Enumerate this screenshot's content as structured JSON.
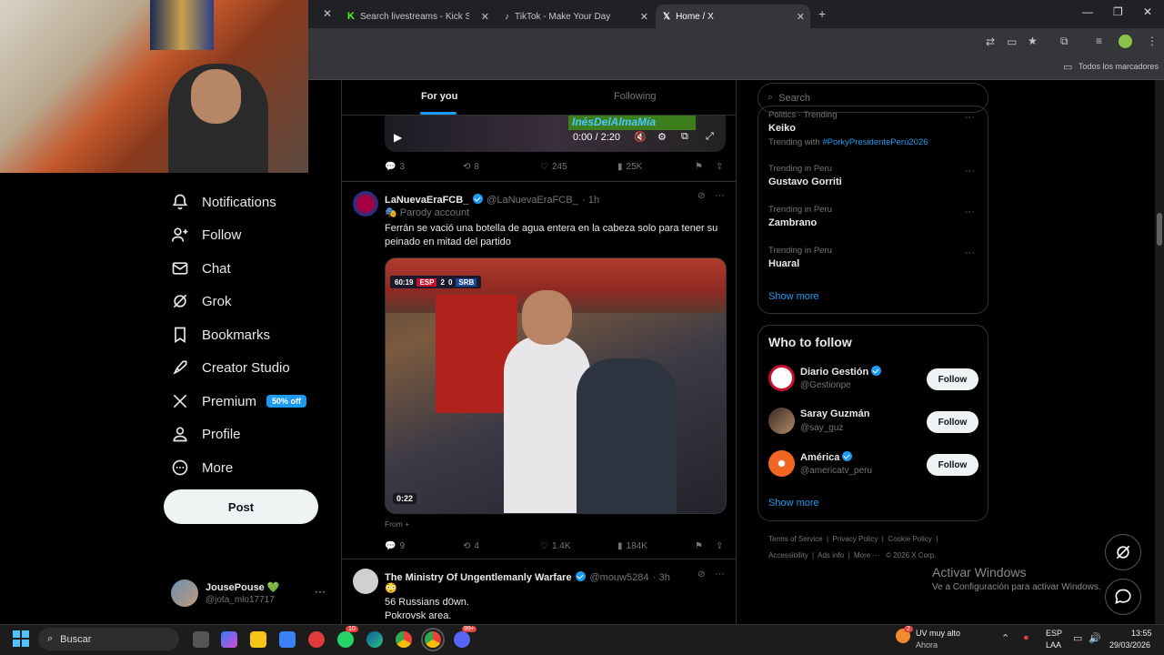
{
  "browser": {
    "tabs": [
      {
        "label": "Search livestreams - Kick Stream",
        "icon": "kick-icon"
      },
      {
        "label": "TikTok - Make Your Day",
        "icon": "tiktok-icon"
      },
      {
        "label": "Home / X",
        "icon": "x-icon"
      }
    ],
    "bookmarks_label": "Todos los marcadores"
  },
  "nav": {
    "items": [
      {
        "label": "Notifications",
        "icon": "bell-icon"
      },
      {
        "label": "Follow",
        "icon": "person-plus-icon"
      },
      {
        "label": "Chat",
        "icon": "mail-icon"
      },
      {
        "label": "Grok",
        "icon": "grok-icon"
      },
      {
        "label": "Bookmarks",
        "icon": "bookmark-icon"
      },
      {
        "label": "Creator Studio",
        "icon": "rocket-icon"
      },
      {
        "label": "Premium",
        "icon": "x-logo-icon"
      },
      {
        "label": "Profile",
        "icon": "person-icon"
      },
      {
        "label": "More",
        "icon": "more-circle-icon"
      }
    ],
    "premium_badge": "50% off",
    "post_label": "Post",
    "account": {
      "name": "JousePouse 💚",
      "handle": "@jota_mlo17717"
    }
  },
  "feed": {
    "tabs": [
      "For you",
      "Following"
    ],
    "top_video": {
      "overlay_text": "InésDelAlmaMía",
      "time": "0:00 / 2:20"
    },
    "top_actions": {
      "replies": "3",
      "reposts": "8",
      "likes": "245",
      "views": "25K"
    },
    "tweet1": {
      "name": "LaNuevaEraFCB_",
      "handle": "@LaNuevaEraFCB_",
      "time": "· 1h",
      "label": "Parody account",
      "text": "Ferrán se vació una botella de agua entera en la cabeza solo para tener su peinado en mitad del partido",
      "scoreboard": {
        "clock": "60:19",
        "home": "ESP",
        "home_score": "2",
        "away_score": "0",
        "away": "SRB"
      },
      "video_time": "0:22",
      "from": "From",
      "actions": {
        "replies": "9",
        "reposts": "4",
        "likes": "1.4K",
        "views": "184K"
      }
    },
    "tweet2": {
      "name": "The Ministry Of Ungentlemanly Warfare",
      "handle": "@mouw5284",
      "time": "· 3h",
      "emoji": "😳",
      "line1": "56 Russians d0wn.",
      "line2": "Pokrovsk area."
    }
  },
  "right": {
    "search_placeholder": "Search",
    "trends": [
      {
        "context": "Politics · Trending",
        "name": "Keiko",
        "extra": "Trending with",
        "tag": "#PorkyPresidentePerú2026"
      },
      {
        "context": "Trending in Peru",
        "name": "Gustavo Gorriti"
      },
      {
        "context": "Trending in Peru",
        "name": "Zambrano"
      },
      {
        "context": "Trending in Peru",
        "name": "Huaral"
      }
    ],
    "show_more": "Show more",
    "who_to_follow_title": "Who to follow",
    "who_to_follow": [
      {
        "name": "Diario Gestión",
        "handle": "@Gestionpe",
        "verified": true,
        "avatar_color": "#c8102e"
      },
      {
        "name": "Saray Guzmán",
        "handle": "@say_guz",
        "verified": false,
        "avatar_color": "#7a5a44"
      },
      {
        "name": "América",
        "handle": "@americatv_peru",
        "verified": true,
        "avatar_color": "#f26522"
      }
    ],
    "follow_label": "Follow",
    "footer_line1": [
      "Terms of Service",
      "Privacy Policy",
      "Cookie Policy"
    ],
    "footer_line2": [
      "Accessibility",
      "Ads info",
      "More ···",
      "© 2026 X Corp."
    ]
  },
  "activate_windows": {
    "title": "Activar Windows",
    "subtitle": "Ve a Configuración para activar Windows."
  },
  "taskbar": {
    "search_placeholder": "Buscar",
    "weather": {
      "temp": "UV muy alto",
      "sub": "Ahora"
    },
    "lang": {
      "line1": "ESP",
      "line2": "LAA"
    },
    "time": "13:55",
    "date": "29/03/2026",
    "badges": {
      "whatsapp": "10",
      "discord": "99+",
      "weather": "2"
    }
  },
  "colors": {
    "accent": "#1d9bf0",
    "background": "#000000",
    "border": "#2f3336",
    "muted": "#71767b"
  }
}
